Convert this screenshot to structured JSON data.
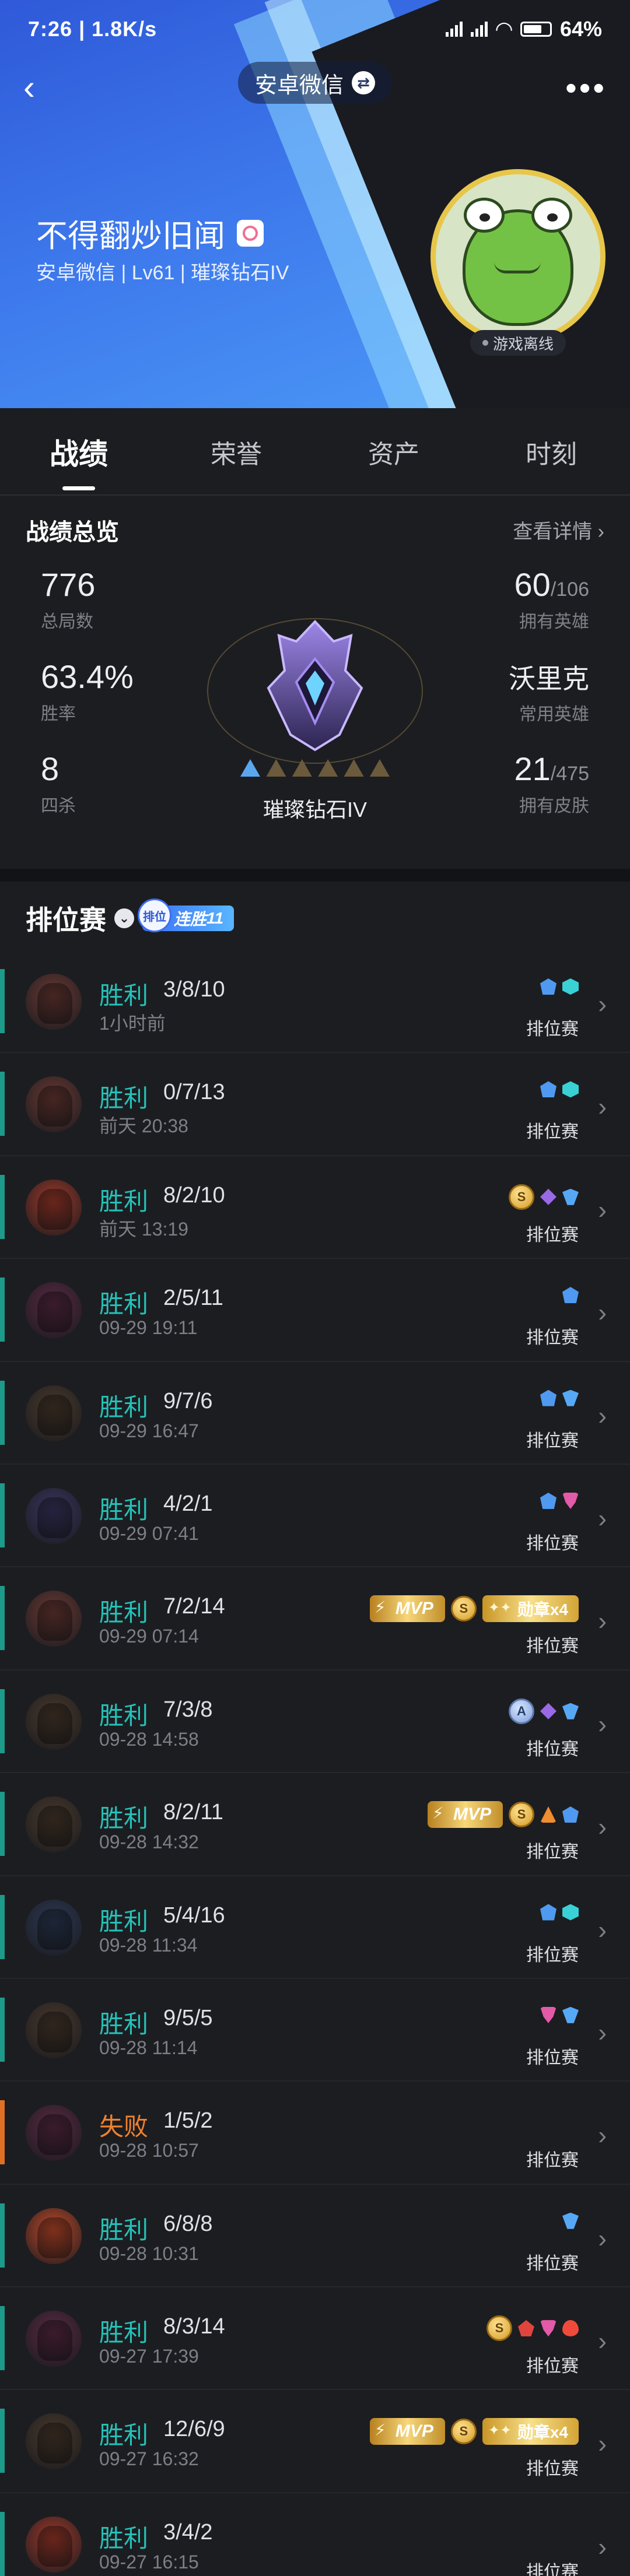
{
  "status_bar": {
    "time": "7:26",
    "speed": "1.8K/s",
    "battery": "64"
  },
  "nav": {
    "server": "安卓微信"
  },
  "profile": {
    "name": "不得翻炒旧闻",
    "subtitle": "安卓微信 | Lv61 | 璀璨钻石IV",
    "online_status": "游戏离线"
  },
  "tabs": [
    "战绩",
    "荣誉",
    "资产",
    "时刻"
  ],
  "overview": {
    "title": "战绩总览",
    "detail_link": "查看详情",
    "total_matches": {
      "value": "776",
      "label": "总局数"
    },
    "win_rate": {
      "value": "63.4%",
      "label": "胜率"
    },
    "quadra_kills": {
      "value": "8",
      "label": "四杀"
    },
    "heroes_owned": {
      "value": "60",
      "total": "/106",
      "label": "拥有英雄"
    },
    "common_hero": {
      "value": "沃里克",
      "label": "常用英雄"
    },
    "skins_owned": {
      "value": "21",
      "total": "/475",
      "label": "拥有皮肤"
    },
    "rank_name": "璀璨钻石IV",
    "stars_lit": 1,
    "stars_total": 6
  },
  "ranked": {
    "title": "排位赛",
    "streak_icon_text": "排位",
    "streak_label": "连胜",
    "streak_count": "11"
  },
  "matches": [
    {
      "result": "胜利",
      "kda": "3/8/10",
      "time": "1小时前",
      "mode": "排位赛",
      "outcome": "win",
      "hero_color": "#6b3a34",
      "badges": [
        "blue",
        "cyan"
      ]
    },
    {
      "result": "胜利",
      "kda": "0/7/13",
      "time": "前天 20:38",
      "mode": "排位赛",
      "outcome": "win",
      "hero_color": "#6b3a34",
      "badges": [
        "blue",
        "cyan"
      ]
    },
    {
      "result": "胜利",
      "kda": "8/2/10",
      "time": "前天 13:19",
      "mode": "排位赛",
      "outcome": "win",
      "hero_color": "#a13a2a",
      "badges": [
        "coin",
        "purple",
        "skyblue"
      ],
      "coin": "S"
    },
    {
      "result": "胜利",
      "kda": "2/5/11",
      "time": "09-29 19:11",
      "mode": "排位赛",
      "outcome": "win",
      "hero_color": "#5a2a44",
      "badges": [
        "blue"
      ]
    },
    {
      "result": "胜利",
      "kda": "9/7/6",
      "time": "09-29 16:47",
      "mode": "排位赛",
      "outcome": "win",
      "hero_color": "#4a3a2c",
      "badges": [
        "blue",
        "skyblue"
      ]
    },
    {
      "result": "胜利",
      "kda": "4/2/1",
      "time": "09-29 07:41",
      "mode": "排位赛",
      "outcome": "win",
      "hero_color": "#3a3560",
      "badges": [
        "blue",
        "pink"
      ]
    },
    {
      "result": "胜利",
      "kda": "7/2/14",
      "time": "09-29 07:14",
      "mode": "排位赛",
      "outcome": "win",
      "hero_color": "#6b3a34",
      "badges": [
        "mvp",
        "coin",
        "medal"
      ],
      "mvp": "MVP",
      "coin": "S",
      "medal": "勋章x4"
    },
    {
      "result": "胜利",
      "kda": "7/3/8",
      "time": "09-28 14:58",
      "mode": "排位赛",
      "outcome": "win",
      "hero_color": "#4a3a2c",
      "badges": [
        "coinblue",
        "purple",
        "skyblue"
      ],
      "coin": "A"
    },
    {
      "result": "胜利",
      "kda": "8/2/11",
      "time": "09-28 14:32",
      "mode": "排位赛",
      "outcome": "win",
      "hero_color": "#4a3a2c",
      "badges": [
        "mvp",
        "coin",
        "orange",
        "blue"
      ],
      "mvp": "MVP",
      "coin": "S"
    },
    {
      "result": "胜利",
      "kda": "5/4/16",
      "time": "09-28 11:34",
      "mode": "排位赛",
      "outcome": "win",
      "hero_color": "#2c3a55",
      "badges": [
        "blue",
        "cyan"
      ]
    },
    {
      "result": "胜利",
      "kda": "9/5/5",
      "time": "09-28 11:14",
      "mode": "排位赛",
      "outcome": "win",
      "hero_color": "#4a3a2c",
      "badges": [
        "pink",
        "skyblue"
      ]
    },
    {
      "result": "失败",
      "kda": "1/5/2",
      "time": "09-28 10:57",
      "mode": "排位赛",
      "outcome": "lose",
      "hero_color": "#5a2a44",
      "badges": []
    },
    {
      "result": "胜利",
      "kda": "6/8/8",
      "time": "09-28 10:31",
      "mode": "排位赛",
      "outcome": "win",
      "hero_color": "#c24a2a",
      "badges": [
        "skyblue"
      ]
    },
    {
      "result": "胜利",
      "kda": "8/3/14",
      "time": "09-27 17:39",
      "mode": "排位赛",
      "outcome": "win",
      "hero_color": "#5a2a44",
      "badges": [
        "coin",
        "red",
        "pink",
        "flame"
      ],
      "coin": "S"
    },
    {
      "result": "胜利",
      "kda": "12/6/9",
      "time": "09-27 16:32",
      "mode": "排位赛",
      "outcome": "win",
      "hero_color": "#4a3a2c",
      "badges": [
        "mvp",
        "coin",
        "medal"
      ],
      "mvp": "MVP",
      "coin": "S",
      "medal": "勋章x4"
    },
    {
      "result": "胜利",
      "kda": "3/4/2",
      "time": "09-27 16:15",
      "mode": "排位赛",
      "outcome": "win",
      "hero_color": "#a13a2a",
      "badges": []
    }
  ],
  "colors": {
    "win": "#24c2b8",
    "lose": "#f0822e",
    "background": "#1c1d21"
  }
}
